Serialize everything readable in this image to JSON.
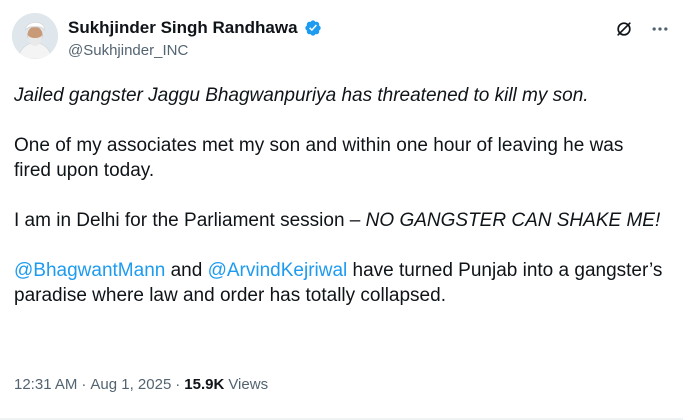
{
  "author": {
    "display_name": "Sukhjinder Singh Randhawa",
    "handle": "@Sukhjinder_INC",
    "verified": true
  },
  "tweet": {
    "line1": "Jailed gangster Jaggu Bhagwanpuriya has threatened to kill my son.",
    "line2": "One of my associates met my son and within one hour of leaving he was fired upon today.",
    "line3_plain": "I am in Delhi for the Parliament session – ",
    "line3_italic": "NO GANGSTER CAN SHAKE ME!",
    "mention1": "@BhagwantMann",
    "joiner": " and ",
    "mention2": "@ArvindKejriwal",
    "line4_rest": " have turned Punjab into a gangster’s paradise where law and order has totally collapsed."
  },
  "meta": {
    "time": "12:31 AM",
    "separator": "·",
    "date": "Aug 1, 2025",
    "views_count": "15.9K",
    "views_label": "Views"
  },
  "icons": {
    "verified": "verified-badge-icon",
    "grok": "grok-icon",
    "more": "more-icon"
  },
  "colors": {
    "accent": "#1d9bf0",
    "text": "#0f1419",
    "muted": "#536471"
  }
}
